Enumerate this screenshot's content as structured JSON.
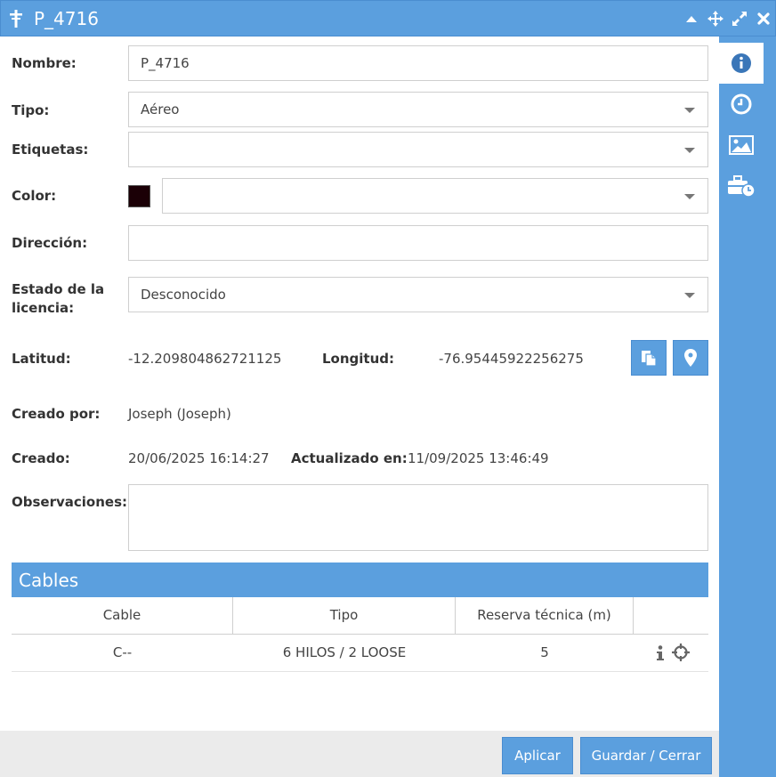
{
  "window": {
    "title": "P_4716"
  },
  "icons": {
    "title": "telephone-pole-icon",
    "minimize": "chevron-up-icon",
    "move": "move-arrows-icon",
    "maximize": "expand-icon",
    "close": "close-icon",
    "tab_info": "info-circle-icon",
    "tab_history": "clock-icon",
    "tab_images": "image-icon",
    "tab_tools": "toolbox-clock-icon",
    "copy": "copy-document-icon",
    "locate": "map-marker-icon",
    "row_info": "info-icon",
    "row_target": "crosshair-icon"
  },
  "colors": {
    "accent": "#5b9fde",
    "swatch": "#1b0006"
  },
  "form": {
    "nombre_label": "Nombre:",
    "nombre_value": "P_4716",
    "tipo_label": "Tipo:",
    "tipo_value": "Aéreo",
    "etiquetas_label": "Etiquetas:",
    "etiquetas_value": "",
    "color_label": "Color:",
    "color_value": "",
    "direccion_label": "Dirección:",
    "direccion_value": "",
    "estado_label_line1": "Estado de la",
    "estado_label_line2": "licencia:",
    "estado_value": "Desconocido",
    "latitud_label": "Latitud:",
    "latitud_value": "-12.209804862721125",
    "longitud_label": "Longitud:",
    "longitud_value": "-76.95445922256275",
    "creado_por_label": "Creado por:",
    "creado_por_value": "Joseph (Joseph)",
    "creado_label": "Creado:",
    "creado_value": "20/06/2025 16:14:27",
    "actualizado_label": "Actualizado en:",
    "actualizado_value": "11/09/2025 13:46:49",
    "observaciones_label": "Observaciones:",
    "observaciones_value": ""
  },
  "cables": {
    "title": "Cables",
    "columns": [
      "Cable",
      "Tipo",
      "Reserva técnica (m)",
      ""
    ],
    "rows": [
      {
        "cable": "C--",
        "tipo": "6 HILOS / 2 LOOSE",
        "reserva": "5"
      }
    ]
  },
  "footer": {
    "apply_label": "Aplicar",
    "save_close_label": "Guardar / Cerrar"
  }
}
